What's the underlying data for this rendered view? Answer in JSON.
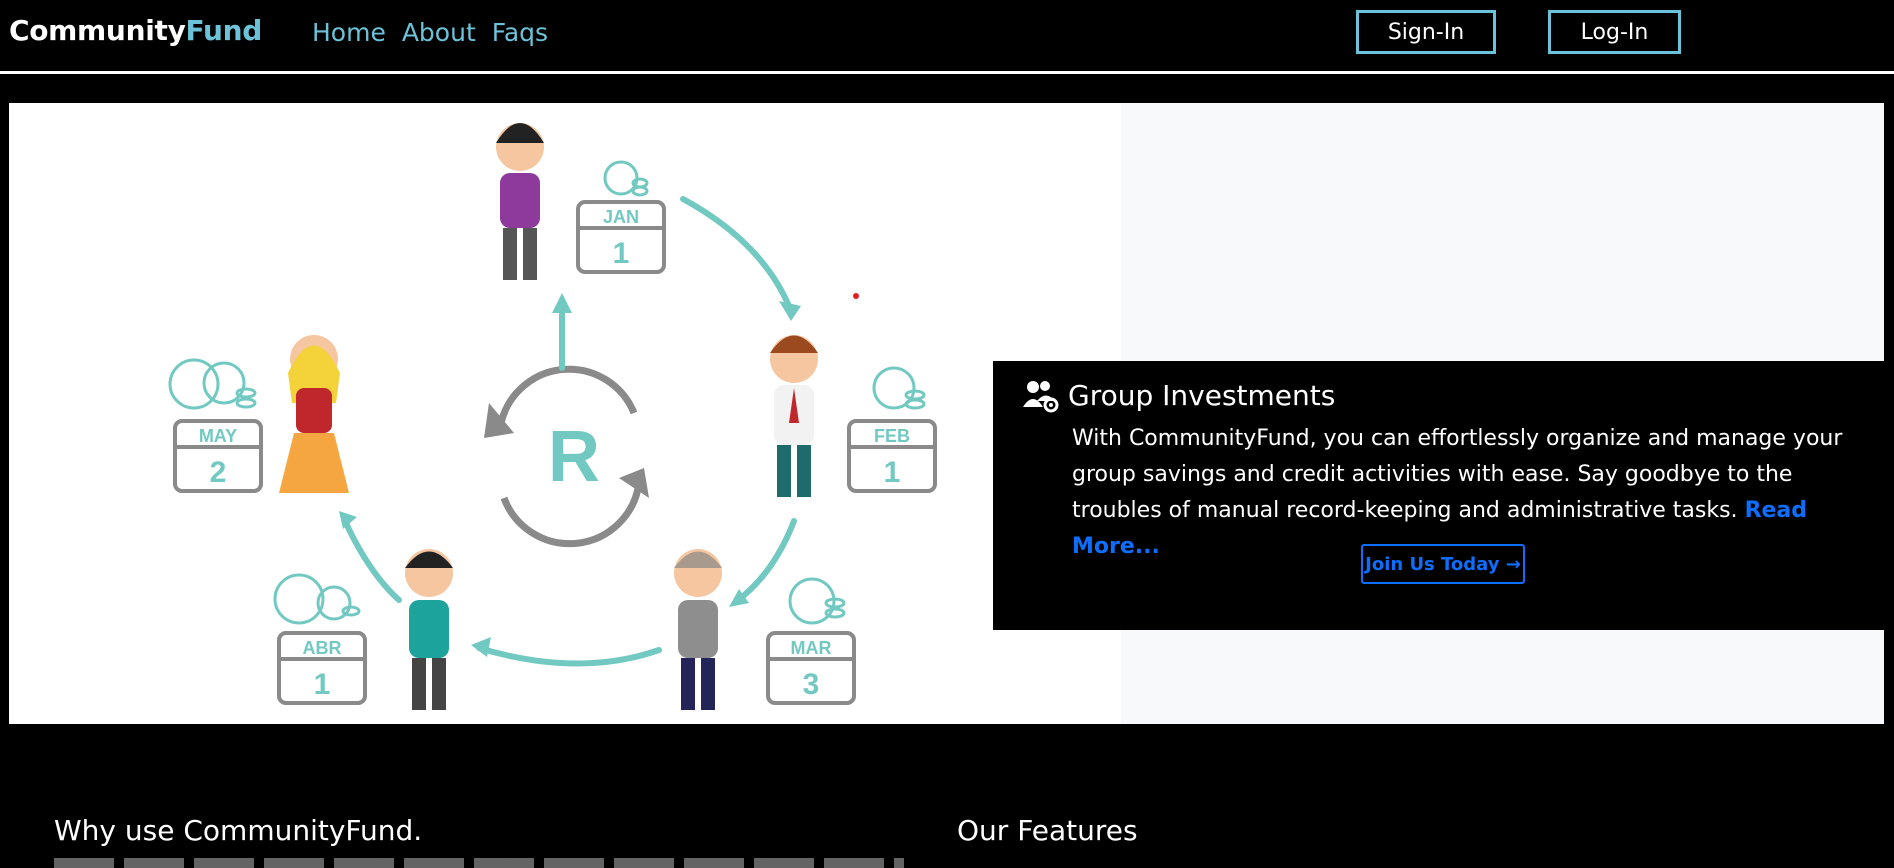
{
  "brand": {
    "part1": "Community",
    "part2": "Fund"
  },
  "nav": {
    "items": [
      "Home",
      "About",
      "Faqs"
    ]
  },
  "auth": {
    "signin": "Sign-In",
    "login": "Log-In"
  },
  "hero": {
    "calendars": [
      {
        "month": "JAN",
        "day": "1"
      },
      {
        "month": "FEB",
        "day": "1"
      },
      {
        "month": "MAR",
        "day": "3"
      },
      {
        "month": "ABR",
        "day": "1"
      },
      {
        "month": "MAY",
        "day": "2"
      }
    ],
    "center_letter": "R"
  },
  "card": {
    "title": "Group Investments",
    "text": "With CommunityFund, you can effortlessly organize and manage your group savings and credit activities with ease. Say goodbye to the troubles of manual record-keeping and administrative tasks.",
    "read_more": "Read More...",
    "join": "Join Us Today →",
    "icon": "users-gear-icon"
  },
  "sections": {
    "why": "Why use CommunityFund.",
    "features": "Our Features"
  },
  "colors": {
    "accent": "#6cc3d9",
    "link": "#0d6efd",
    "teal": "#72c9c2",
    "gray": "#8a8a8a"
  }
}
